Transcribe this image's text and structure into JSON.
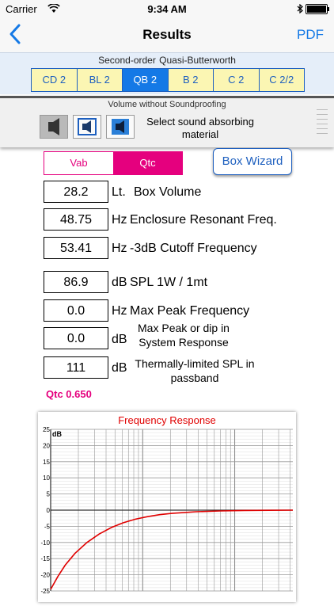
{
  "status_bar": {
    "carrier": "Carrier",
    "time": "9:34 AM"
  },
  "nav": {
    "title": "Results",
    "action": "PDF"
  },
  "alignment": {
    "label": "Second-order  Quasi-Butterworth",
    "segments": [
      "CD 2",
      "BL 2",
      "QB 2",
      "B 2",
      "C 2",
      "C 2/2"
    ],
    "selected": "QB 2"
  },
  "soundproofing": {
    "label": "Volume without Soundproofing",
    "text": "Select sound absorbing material"
  },
  "toggle": {
    "left": "Vab",
    "right": "Qtc",
    "selected": "Qtc"
  },
  "box_wizard": "Box Wizard",
  "rows": [
    {
      "value": "28.2",
      "unit": "Lt.",
      "desc": "Box Volume"
    },
    {
      "value": "48.75",
      "unit": "Hz",
      "desc": "Enclosure Resonant Freq."
    },
    {
      "value": "53.41",
      "unit": "Hz",
      "desc": "-3dB Cutoff Frequency"
    },
    {
      "value": "86.9",
      "unit": "dB",
      "desc": "SPL 1W / 1mt"
    },
    {
      "value": "0.0",
      "unit": "Hz",
      "desc": "Max Peak Frequency"
    },
    {
      "value": "0.0",
      "unit": "dB",
      "desc": "Max Peak or dip in System  Response"
    },
    {
      "value": "111",
      "unit": "dB",
      "desc": "Thermally-limited SPL in passband"
    }
  ],
  "qtc_label": "Qtc 0.650",
  "chart_data": {
    "type": "line",
    "title": "Frequency Response",
    "ylabel": "dB",
    "yticks": [
      25,
      20,
      15,
      10,
      5,
      0,
      -5,
      -10,
      -15,
      -20,
      -25
    ],
    "ylim": [
      -25,
      25
    ],
    "x": [
      0.0,
      0.03,
      0.06,
      0.1,
      0.15,
      0.2,
      0.25,
      0.3,
      0.35,
      0.4,
      0.45,
      0.5,
      0.6,
      0.7,
      0.8,
      0.9,
      1.0
    ],
    "series": [
      {
        "color": "#e00000",
        "values": [
          -24.5,
          -20.5,
          -17.0,
          -13.4,
          -10.0,
          -7.4,
          -5.4,
          -3.9,
          -2.8,
          -2.0,
          -1.4,
          -1.0,
          -0.5,
          -0.25,
          -0.1,
          -0.05,
          0.0
        ]
      }
    ],
    "grid": true
  },
  "colors": {
    "accent": "#1479e6",
    "magenta": "#e5007e",
    "segment_bg": "#fbf6b3"
  }
}
